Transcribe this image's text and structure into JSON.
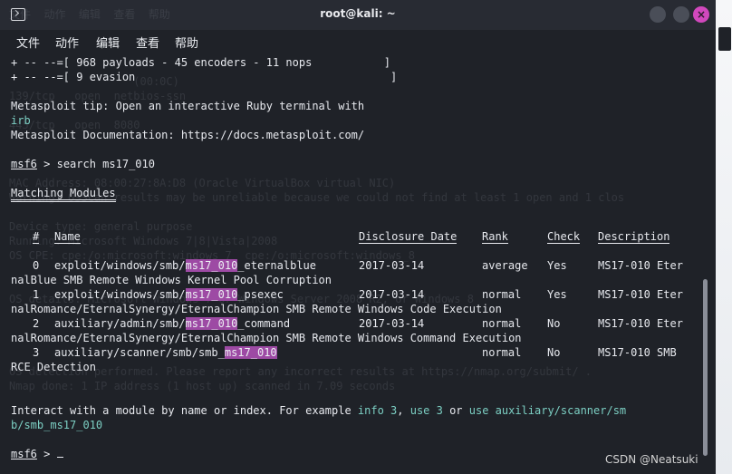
{
  "window": {
    "title": "root@kali: ~"
  },
  "menu": [
    "文件",
    "动作",
    "编辑",
    "查看",
    "帮助"
  ],
  "terminal": {
    "payloads_line": "+ -- --=[ 968 payloads - 45 encoders - 11 nops           ]",
    "evasion_line": "+ -- --=[ 9 evasion                                       ]",
    "tip_line": "Metasploit tip: Open an interactive Ruby terminal with",
    "tip_cmd": "irb",
    "doc_line": "Metasploit Documentation: https://docs.metasploit.com/",
    "prompt_name": "msf6",
    "prompt_gt": " > ",
    "search_cmd": "search ms17_010",
    "matching_modules": "Matching Modules",
    "headers": {
      "num": "#",
      "name": "Name",
      "date": "Disclosure Date",
      "rank": "Rank",
      "check": "Check",
      "description": "Description"
    },
    "rows": [
      {
        "num": "0",
        "name_prefix": "exploit/windows/smb/",
        "match": "ms17_010",
        "name_suffix": "_eternalblue",
        "date": "2017-03-14",
        "rank": "average",
        "check": "Yes",
        "desc": "MS17-010 Eter",
        "wrap": "nalBlue SMB Remote Windows Kernel Pool Corruption"
      },
      {
        "num": "1",
        "name_prefix": "exploit/windows/smb/",
        "match": "ms17_010",
        "name_suffix": "_psexec",
        "date": "2017-03-14",
        "rank": "normal",
        "check": "Yes",
        "desc": "MS17-010 Eter",
        "wrap": "nalRomance/EternalSynergy/EternalChampion SMB Remote Windows Code Execution"
      },
      {
        "num": "2",
        "name_prefix": "auxiliary/admin/smb/",
        "match": "ms17_010",
        "name_suffix": "_command",
        "date": "2017-03-14",
        "rank": "normal",
        "check": "No",
        "desc": "MS17-010 Eter",
        "wrap": "nalRomance/EternalSynergy/EternalChampion SMB Remote Windows Command Execution"
      },
      {
        "num": "3",
        "name_prefix": "auxiliary/scanner/smb/smb_",
        "match": "ms17_010",
        "name_suffix": "",
        "date": "",
        "rank": "normal",
        "check": "No",
        "desc": "MS17-010 SMB",
        "wrap": "RCE Detection"
      }
    ],
    "interact_text": "Interact with a module by name or index. For example ",
    "interact_info": "info 3",
    "interact_sep1": ", ",
    "interact_use": "use 3",
    "interact_or": " or ",
    "interact_use_path": "use auxiliary/scanner/sm",
    "interact_use_path2": "b/smb_ms17_010",
    "ghost_lines": [
      "文件  动作  编辑  查看  帮助",
      "                          )",
      "                   (00:0C) ",
      "139/tcp   open  netbios-ssn",
      "445/tcp   open  8080  ",
      "MAC Address: 08:00:27:8A:D8 (Oracle VirtualBox virtual NIC)",
      "Warning: OSScan results may be unreliable because we could not find at least 1 open and 1 clos",
      "Device type: general purpose",
      "Running: Microsoft Windows 7|8|Vista|2008",
      "OS CPE: cpe:/o:microsoft:windows_7  cpe:/o:microsoft:windows_8",
      "OS details: Microsoft Windows 7 or Windows Server 2008 R2, or Windows 8",
      "OS detection performed. Please report any incorrect results at https://nmap.org/submit/ .",
      "Nmap done: 1 IP address (1 host up) scanned in 7.09 seconds"
    ]
  },
  "watermark": "CSDN @Neatsuki"
}
